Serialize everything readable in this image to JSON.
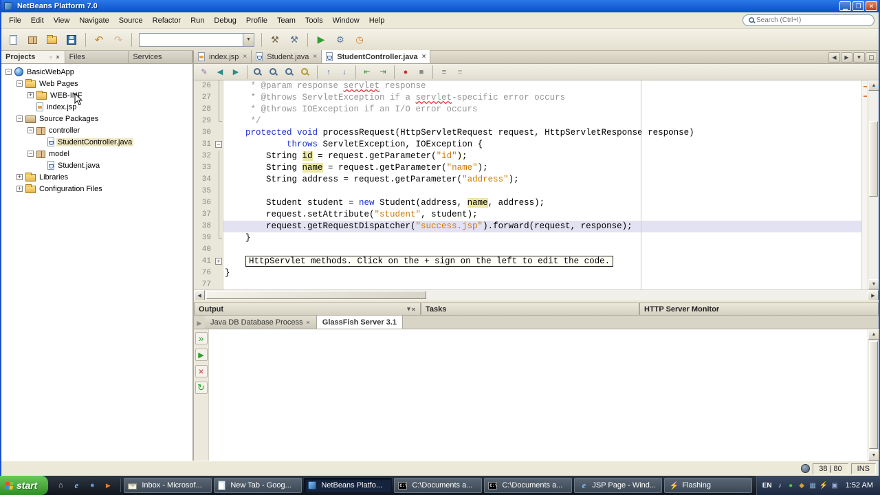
{
  "colors": {
    "titlebar_top": "#2a77e8",
    "titlebar_bottom": "#0b50c8",
    "keyword": "#1a30c8",
    "string": "#ce7b00",
    "comment": "#969696",
    "occurrence_bg": "#ece8a2",
    "current_line_bg": "#e2e2f2",
    "margin_line": "#f0b8b8",
    "taskbar_top": "#2c3642",
    "taskbar_bottom": "#11161d",
    "task_button": "#5a6674",
    "task_button_active": "#16233c",
    "start_green": "#2e8f26"
  },
  "titlebar": {
    "title": "NetBeans Platform 7.0"
  },
  "menubar": {
    "items": [
      "File",
      "Edit",
      "View",
      "Navigate",
      "Source",
      "Refactor",
      "Run",
      "Debug",
      "Profile",
      "Team",
      "Tools",
      "Window",
      "Help"
    ],
    "search_placeholder": "Search (Ctrl+I)"
  },
  "main_toolbar": {
    "items": [
      "new-file-icon",
      "new-project-icon",
      "open-project-icon",
      "save-all-icon",
      "|",
      "undo-icon",
      "redo-icon",
      "|",
      "combo",
      "|",
      "build-project-icon",
      "clean-build-icon",
      "|",
      "run-project-icon",
      "debug-project-icon",
      "profile-project-icon"
    ],
    "config_combo_value": ""
  },
  "explorer": {
    "tabs": [
      {
        "label": "Projects",
        "active": true
      },
      {
        "label": "Files",
        "active": false
      },
      {
        "label": "Services",
        "active": false
      }
    ],
    "tree": [
      {
        "label": "BasicWebApp",
        "level": 0,
        "icon": "project-icon",
        "toggle": "-"
      },
      {
        "label": "Web Pages",
        "level": 1,
        "icon": "folder-icon",
        "toggle": "-"
      },
      {
        "label": "WEB-INF",
        "level": 2,
        "icon": "folder-icon",
        "toggle": "+"
      },
      {
        "label": "index.jsp",
        "level": 2,
        "icon": "jsp-icon",
        "toggle": ""
      },
      {
        "label": "Source Packages",
        "level": 1,
        "icon": "package-root-icon",
        "toggle": "-"
      },
      {
        "label": "controller",
        "level": 2,
        "icon": "package-icon",
        "toggle": "-"
      },
      {
        "label": "StudentController.java",
        "level": 3,
        "icon": "java-icon",
        "toggle": "",
        "highlight": true
      },
      {
        "label": "model",
        "level": 2,
        "icon": "package-icon",
        "toggle": "-"
      },
      {
        "label": "Student.java",
        "level": 3,
        "icon": "java-icon",
        "toggle": ""
      },
      {
        "label": "Libraries",
        "level": 1,
        "icon": "folder-icon",
        "toggle": "+"
      },
      {
        "label": "Configuration Files",
        "level": 1,
        "icon": "folder-icon",
        "toggle": "+"
      }
    ]
  },
  "editor": {
    "tabs": [
      {
        "label": "index.jsp",
        "icon": "jsp-file-icon",
        "active": false
      },
      {
        "label": "Student.java",
        "icon": "java-file-icon",
        "active": false
      },
      {
        "label": "StudentController.java",
        "icon": "java-file-icon",
        "active": true
      }
    ],
    "tab_controls": [
      "tab-scroll-left-icon",
      "tab-scroll-right-icon",
      "tab-list-icon",
      "maximize-editor-icon"
    ],
    "toolbar_items": [
      "last-edit-icon",
      "back-icon",
      "forward-icon",
      "|",
      "find-selection-icon",
      "find-next-icon",
      "find-previous-icon",
      "toggle-highlight-icon",
      "|",
      "previous-bookmark-icon",
      "next-bookmark-icon",
      "|",
      "shift-left-icon",
      "shift-right-icon",
      "|",
      "breakpoint-icon",
      "stop-macro-icon",
      "|",
      "comment-icon",
      "uncomment-icon"
    ],
    "lines": [
      {
        "n": "26",
        "fold": "|",
        "seg": [
          [
            "c",
            "     * @param response "
          ],
          [
            "cw",
            "servlet"
          ],
          [
            "c",
            " response"
          ]
        ]
      },
      {
        "n": "27",
        "fold": "|",
        "seg": [
          [
            "c",
            "     * @throws ServletException if a "
          ],
          [
            "cw",
            "servlet"
          ],
          [
            "c",
            "-specific error occurs"
          ]
        ]
      },
      {
        "n": "28",
        "fold": "|",
        "seg": [
          [
            "c",
            "     * @throws IOException if an I/O error occurs"
          ]
        ]
      },
      {
        "n": "29",
        "fold": "L",
        "seg": [
          [
            "c",
            "     */"
          ]
        ]
      },
      {
        "n": "30",
        "fold": "",
        "seg": [
          [
            "p",
            "    "
          ],
          [
            "k",
            "protected"
          ],
          [
            "p",
            " "
          ],
          [
            "k",
            "void"
          ],
          [
            "p",
            " processRequest(HttpServletRequest request, HttpServletResponse response)"
          ]
        ]
      },
      {
        "n": "31",
        "fold": "-",
        "seg": [
          [
            "p",
            "            "
          ],
          [
            "k",
            "throws"
          ],
          [
            "p",
            " ServletException, IOException {"
          ]
        ]
      },
      {
        "n": "32",
        "fold": "|",
        "seg": [
          [
            "p",
            "        String "
          ],
          [
            "h",
            "id"
          ],
          [
            "p",
            " = request.getParameter("
          ],
          [
            "s",
            "\"id\""
          ],
          [
            "p",
            ");"
          ]
        ]
      },
      {
        "n": "33",
        "fold": "|",
        "seg": [
          [
            "p",
            "        String "
          ],
          [
            "h",
            "name"
          ],
          [
            "p",
            " = request.getParameter("
          ],
          [
            "s",
            "\"name\""
          ],
          [
            "p",
            ");"
          ]
        ]
      },
      {
        "n": "34",
        "fold": "|",
        "seg": [
          [
            "p",
            "        String address = request.getParameter("
          ],
          [
            "s",
            "\"address\""
          ],
          [
            "p",
            ");"
          ]
        ]
      },
      {
        "n": "35",
        "fold": "|",
        "seg": []
      },
      {
        "n": "36",
        "fold": "|",
        "seg": [
          [
            "p",
            "        Student student = "
          ],
          [
            "k",
            "new"
          ],
          [
            "p",
            " Student(address, "
          ],
          [
            "h",
            "name"
          ],
          [
            "p",
            ", address);"
          ]
        ]
      },
      {
        "n": "37",
        "fold": "|",
        "seg": [
          [
            "p",
            "        request.setAttribute("
          ],
          [
            "s",
            "\"student\""
          ],
          [
            "p",
            ", student);"
          ]
        ]
      },
      {
        "n": "38",
        "fold": "|",
        "current": true,
        "seg": [
          [
            "p",
            "        request.getRequestDispatcher("
          ],
          [
            "s",
            "\"success.jsp\""
          ],
          [
            "p",
            ").forward(request, response);"
          ]
        ]
      },
      {
        "n": "39",
        "fold": "L",
        "seg": [
          [
            "p",
            "    }"
          ]
        ]
      },
      {
        "n": "40",
        "fold": "",
        "seg": []
      },
      {
        "n": "41",
        "fold": "+",
        "box": "HttpServlet methods. Click on the + sign on the left to edit the code."
      },
      {
        "n": "76",
        "fold": "",
        "seg": [
          [
            "p",
            "}"
          ]
        ]
      },
      {
        "n": "77",
        "fold": "",
        "seg": []
      }
    ]
  },
  "bottom": {
    "windows": [
      {
        "label": "Output",
        "active": true,
        "icons": [
          "filter-icon",
          "close-icon"
        ]
      },
      {
        "label": "Tasks",
        "active": false,
        "icons": []
      },
      {
        "label": "HTTP Server Monitor",
        "active": false,
        "icons": []
      }
    ],
    "output_tabs": [
      {
        "label": "Java DB Database Process",
        "closable": true,
        "active": false
      },
      {
        "label": "GlassFish Server 3.1",
        "closable": false,
        "active": true
      }
    ],
    "strip_icons": [
      "debug-server-icon",
      "start-server-icon",
      "stop-server-icon",
      "refresh-server-icon"
    ]
  },
  "statusbar": {
    "position": "38 | 80",
    "mode": "INS"
  },
  "taskbar": {
    "start_label": "start",
    "quick_launch": [
      "show-desktop-icon",
      "ie-icon",
      "browser-icon",
      "media-icon"
    ],
    "tasks": [
      {
        "label": "Inbox - Microsof...",
        "icon": "mail-icon",
        "active": false
      },
      {
        "label": "New Tab - Goog...",
        "icon": "page-icon",
        "active": false
      },
      {
        "label": "NetBeans Platfo...",
        "icon": "netbeans-icon",
        "active": true
      },
      {
        "label": "C:\\Documents a...",
        "icon": "cmd-icon",
        "active": false
      },
      {
        "label": "C:\\Documents a...",
        "icon": "cmd-icon",
        "active": false
      },
      {
        "label": "JSP Page - Wind...",
        "icon": "ie-icon",
        "active": false
      },
      {
        "label": "Flashing",
        "icon": "app-icon",
        "active": false
      }
    ],
    "tray": {
      "language": "EN",
      "icons": [
        "volume-icon",
        "messenger-icon",
        "shield-icon",
        "network-icon",
        "update-icon",
        "display-icon"
      ],
      "time": "1:52 AM"
    }
  }
}
